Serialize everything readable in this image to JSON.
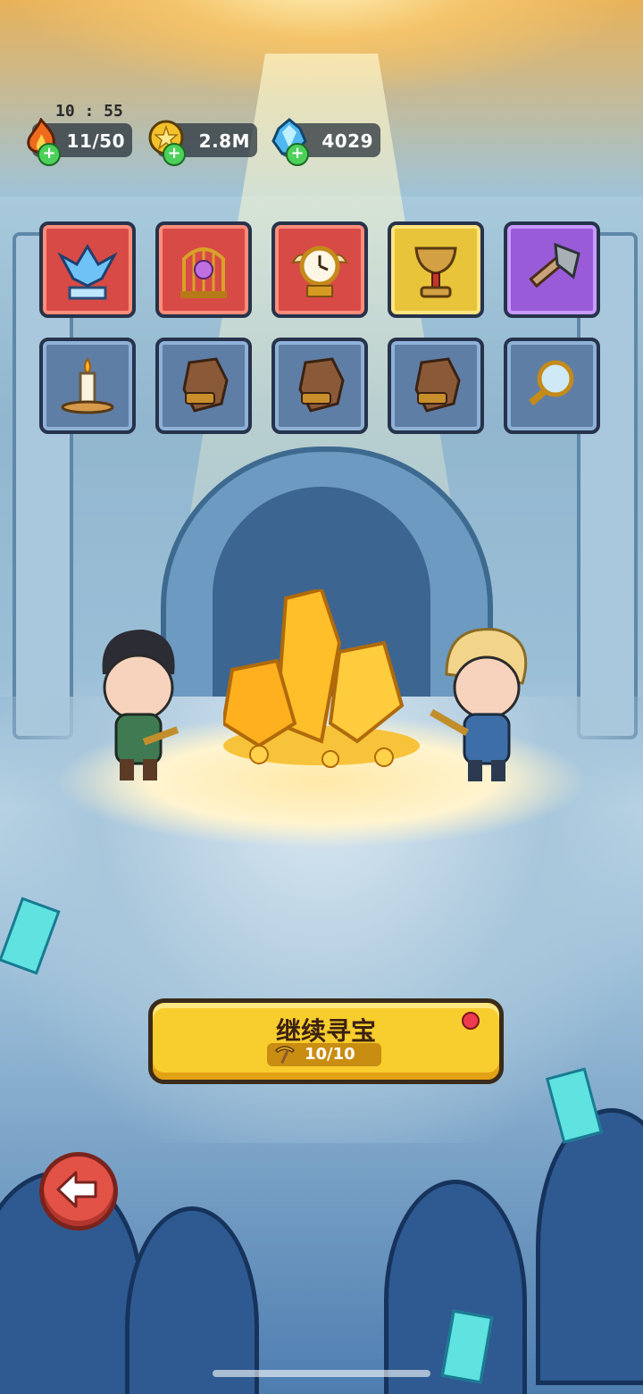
{
  "status_bar": {
    "time": "10 : 55"
  },
  "resources": [
    {
      "name": "energy",
      "icon": "fire-icon",
      "value": "11/50",
      "color": "#f06a1e"
    },
    {
      "name": "coins",
      "icon": "gold-coin-icon",
      "value": "2.8M",
      "color": "#f3c12b"
    },
    {
      "name": "crystals",
      "icon": "blue-crystal-icon",
      "value": "4029",
      "color": "#4fb8f0"
    }
  ],
  "treasure_items": [
    {
      "name": "ice-phoenix-statue",
      "rarity": "red"
    },
    {
      "name": "caged-rose",
      "rarity": "red"
    },
    {
      "name": "winged-clock",
      "rarity": "red"
    },
    {
      "name": "golden-chalice",
      "rarity": "yellow"
    },
    {
      "name": "stone-axe",
      "rarity": "purple"
    },
    {
      "name": "candle",
      "rarity": "blue"
    },
    {
      "name": "leather-glove",
      "rarity": "blue"
    },
    {
      "name": "leather-glove",
      "rarity": "blue"
    },
    {
      "name": "leather-glove",
      "rarity": "blue"
    },
    {
      "name": "magnifying-glass",
      "rarity": "blue"
    }
  ],
  "continue_button": {
    "label": "继续寻宝",
    "pickaxe_count": "10/10"
  },
  "back_button": {
    "icon": "back-arrow-icon"
  }
}
